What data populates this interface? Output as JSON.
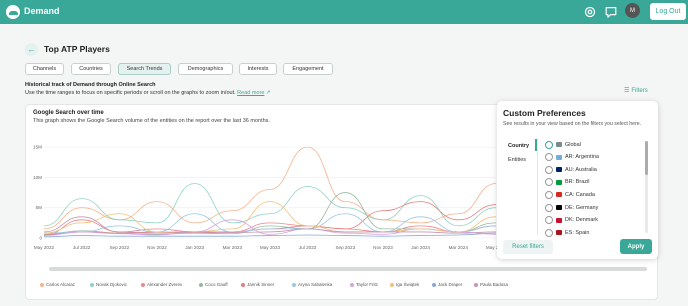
{
  "header": {
    "app_title": "Demand",
    "avatar_initial": "M",
    "logout_label": "Log Out"
  },
  "page": {
    "title": "Top ATP Players",
    "tabs": [
      "Channels",
      "Countries",
      "Search Trends",
      "Demographics",
      "Interests",
      "Engagement"
    ],
    "active_tab": "Search Trends",
    "section_heading": "Historical track of Demand through Online Search",
    "section_desc": "Use the time ranges to focus on specific periods or scroll on the graphs to zoom in/out.",
    "read_more": "Read more",
    "filters_label": "Filters"
  },
  "chart_card": {
    "title": "Google Search over time",
    "description": "This graph shows the Google Search volume of the entities on the report over the last 36 months."
  },
  "chart_data": {
    "type": "line",
    "x": [
      "May 2022",
      "Jul 2022",
      "Sep 2022",
      "Nov 2022",
      "Jan 2023",
      "Mar 2023",
      "May 2023",
      "Jul 2023",
      "Sep 2023",
      "Nov 2023",
      "Jan 2024",
      "Mar 2024",
      "May 2024"
    ],
    "y_ticks": [
      "0",
      "5M",
      "10M",
      "15M"
    ],
    "ylim": [
      0,
      17000000
    ],
    "series": [
      {
        "name": "Carlos Alcaraz",
        "color": "#f5b48e",
        "values": [
          1.5,
          5.0,
          3.0,
          6.0,
          2.5,
          4.5,
          8.0,
          15.0,
          6.0,
          3.0,
          2.5,
          4.0,
          9.0
        ]
      },
      {
        "name": "Novak Djokovic",
        "color": "#8fd3c7",
        "values": [
          2.0,
          6.5,
          3.0,
          2.5,
          9.0,
          2.5,
          4.0,
          8.5,
          5.0,
          3.0,
          7.0,
          2.0,
          5.0
        ]
      },
      {
        "name": "Alexander Zverev",
        "color": "#e9868a",
        "values": [
          0.5,
          3.0,
          1.0,
          1.5,
          1.0,
          1.0,
          2.5,
          2.0,
          1.5,
          1.0,
          2.0,
          1.0,
          2.0
        ]
      },
      {
        "name": "Coco Gauff",
        "color": "#97b9a4",
        "values": [
          0.6,
          1.2,
          0.8,
          0.6,
          0.8,
          0.7,
          2.0,
          1.5,
          7.5,
          1.5,
          1.5,
          1.0,
          2.5
        ]
      },
      {
        "name": "Jannik Sinner",
        "color": "#e57f7f",
        "values": [
          0.5,
          1.0,
          0.8,
          1.0,
          0.8,
          1.0,
          1.5,
          2.0,
          1.5,
          4.5,
          6.0,
          3.0,
          5.5
        ]
      },
      {
        "name": "Aryna Sabalenka",
        "color": "#9cc5e6",
        "values": [
          0.8,
          1.0,
          2.0,
          1.0,
          4.0,
          1.0,
          1.5,
          1.5,
          4.0,
          1.0,
          3.5,
          1.0,
          2.0
        ]
      },
      {
        "name": "Taylor Fritz",
        "color": "#d7a4e0",
        "values": [
          0.4,
          1.0,
          0.7,
          0.5,
          1.0,
          3.0,
          0.6,
          1.5,
          0.8,
          0.6,
          1.5,
          1.0,
          0.6
        ]
      },
      {
        "name": "Iga Świątek",
        "color": "#f0c27a",
        "values": [
          0.8,
          2.5,
          4.0,
          1.0,
          1.0,
          1.5,
          6.0,
          2.0,
          1.0,
          1.0,
          1.5,
          1.0,
          3.5
        ]
      },
      {
        "name": "Jack Draper",
        "color": "#8aa9d9",
        "values": [
          0.2,
          0.4,
          0.3,
          0.3,
          0.3,
          0.3,
          0.4,
          0.5,
          0.4,
          0.3,
          0.4,
          0.5,
          0.8
        ]
      },
      {
        "name": "Paula Badosa",
        "color": "#c596b3",
        "values": [
          1.0,
          3.5,
          1.0,
          0.8,
          1.0,
          0.9,
          1.0,
          1.5,
          1.0,
          1.0,
          1.0,
          0.8,
          1.0
        ]
      }
    ]
  },
  "preferences": {
    "title": "Custom Preferences",
    "description": "See results in your view based on the filters you select here.",
    "tabs": [
      "Country",
      "Entities"
    ],
    "active_tab": "Country",
    "options": [
      {
        "label": "Global",
        "selected": true,
        "flag_color": "#7a8a8a"
      },
      {
        "label": "AR: Argentina",
        "selected": false,
        "flag_color": "#74acdf"
      },
      {
        "label": "AU: Australia",
        "selected": false,
        "flag_color": "#012169"
      },
      {
        "label": "BR: Brazil",
        "selected": false,
        "flag_color": "#009c3b"
      },
      {
        "label": "CA: Canada",
        "selected": false,
        "flag_color": "#d52b1e"
      },
      {
        "label": "DE: Germany",
        "selected": false,
        "flag_color": "#000000"
      },
      {
        "label": "DK: Denmark",
        "selected": false,
        "flag_color": "#c8102e"
      },
      {
        "label": "ES: Spain",
        "selected": false,
        "flag_color": "#aa151b"
      }
    ],
    "reset_label": "Reset filters",
    "apply_label": "Apply"
  }
}
